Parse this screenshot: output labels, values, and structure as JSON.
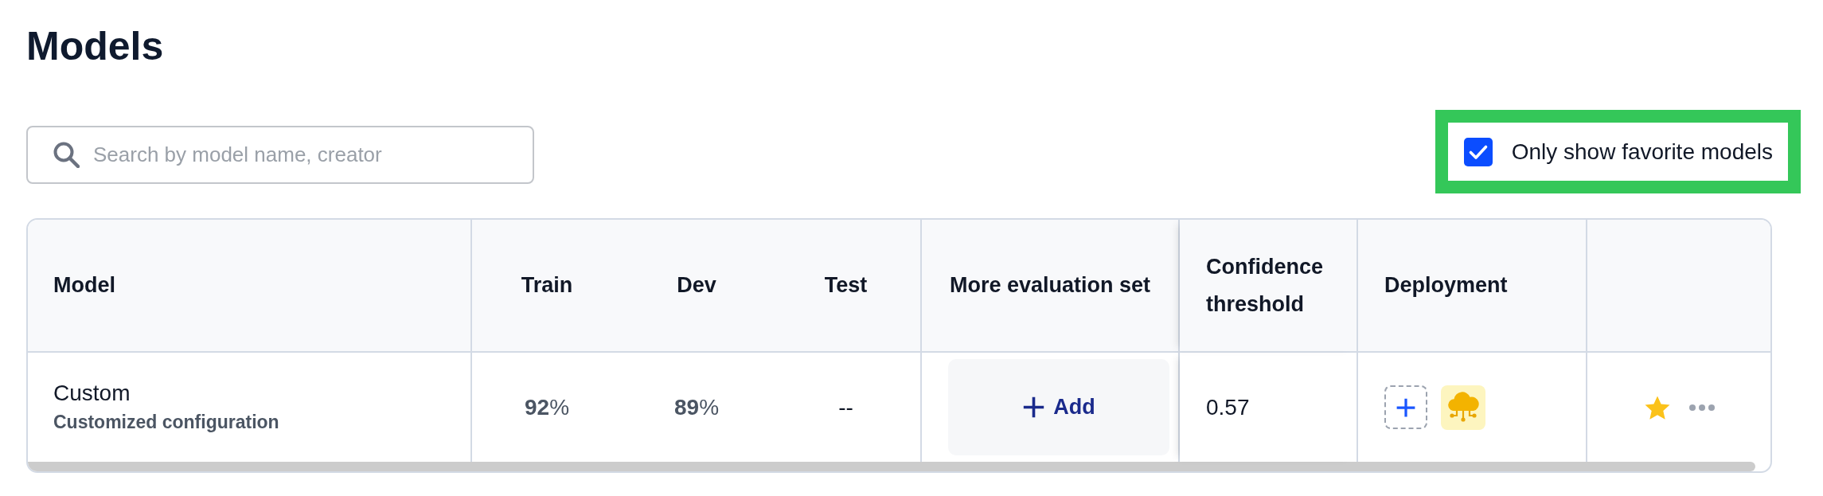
{
  "page": {
    "title": "Models"
  },
  "toolbar": {
    "search": {
      "placeholder": "Search by model name, creator"
    },
    "favorite_filter": {
      "label": "Only show favorite models",
      "checked": true,
      "highlighted": true
    }
  },
  "table": {
    "columns": [
      "Model",
      "Train",
      "Dev",
      "Test",
      "More evaluation set",
      "Confidence threshold",
      "Deployment"
    ],
    "rows": [
      {
        "model": "Custom",
        "description": "Customized configuration",
        "train": "**92**%",
        "dev": "**89**%",
        "test": "--",
        "evaluation_action": "Add",
        "confidence_threshold": "0.57",
        "deployments": [
          {
            "kind": "cloud"
          }
        ],
        "favorite": true
      }
    ]
  }
}
